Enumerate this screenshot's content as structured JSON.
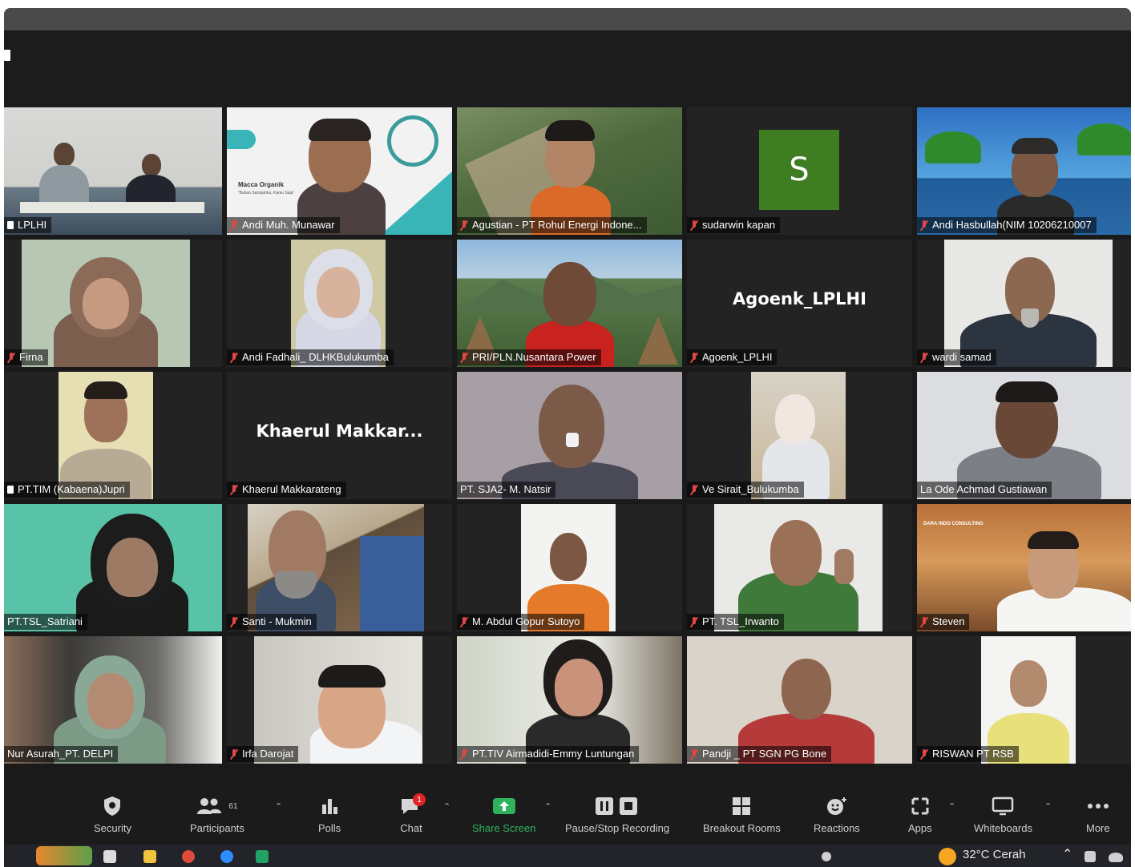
{
  "meeting": {
    "participants_count": "61",
    "chat_badge": "1"
  },
  "participants": [
    {
      "name": "LPLHI",
      "muted": false
    },
    {
      "name": "Andi Muh. Munawar",
      "muted": true
    },
    {
      "name": "Agustian - PT Rohul Energi Indone...",
      "muted": true
    },
    {
      "name": "sudarwin kapan",
      "muted": true,
      "avatar_letter": "S"
    },
    {
      "name": "Andi Hasbullah(NIM 10206210007",
      "muted": true
    },
    {
      "name": "Firna",
      "muted": true
    },
    {
      "name": "Andi Fadhali_ DLHKBulukumba",
      "muted": true
    },
    {
      "name": "PRI/PLN.Nusantara Power",
      "muted": true
    },
    {
      "name": "Agoenk_LPLHI",
      "muted": true,
      "display_name": "Agoenk_LPLHI"
    },
    {
      "name": "wardi samad",
      "muted": true
    },
    {
      "name": "PT.TIM (Kabaena)Jupri",
      "muted": false
    },
    {
      "name": "Khaerul Makkarateng",
      "muted": true,
      "display_name": "Khaerul  Makkar..."
    },
    {
      "name": "PT. SJA2- M. Natsir",
      "muted": false
    },
    {
      "name": "Ve Sirait_Bulukumba",
      "muted": true
    },
    {
      "name": "La Ode Achmad Gustiawan",
      "muted": false
    },
    {
      "name": "PT.TSL_Satriani",
      "muted": false
    },
    {
      "name": "Santi - Mukmin",
      "muted": true
    },
    {
      "name": "M. Abdul Gopur Sutoyo",
      "muted": true
    },
    {
      "name": "PT. TSL_Irwanto",
      "muted": true
    },
    {
      "name": "Steven",
      "muted": true
    },
    {
      "name": "Nur Asurah_PT. DELPI",
      "muted": false
    },
    {
      "name": "Irfa Darojat",
      "muted": true
    },
    {
      "name": "PT.TIV Airmadidi-Emmy Luntungan",
      "muted": true
    },
    {
      "name": "Pandji _ PT SGN PG Bone",
      "muted": true
    },
    {
      "name": "RISWAN PT RSB",
      "muted": true
    }
  ],
  "slide_text": {
    "title": "Macca Organik",
    "subtitle": "\"Bukan Sampahku, Kamu Saja\""
  },
  "background_text": "DARA INDO CONSULTING",
  "toolbar": {
    "security": "Security",
    "participants": "Participants",
    "polls": "Polls",
    "chat": "Chat",
    "share_screen": "Share Screen",
    "recording": "Pause/Stop Recording",
    "breakout": "Breakout Rooms",
    "reactions": "Reactions",
    "apps": "Apps",
    "whiteboards": "Whiteboards",
    "more": "More"
  },
  "taskbar": {
    "weather": "32°C  Cerah"
  },
  "colors": {
    "active_speaker_border": "#d6e04a",
    "share_screen_green": "#2fb25b",
    "muted_red": "#e34646",
    "avatar_green": "#3f7d22"
  }
}
